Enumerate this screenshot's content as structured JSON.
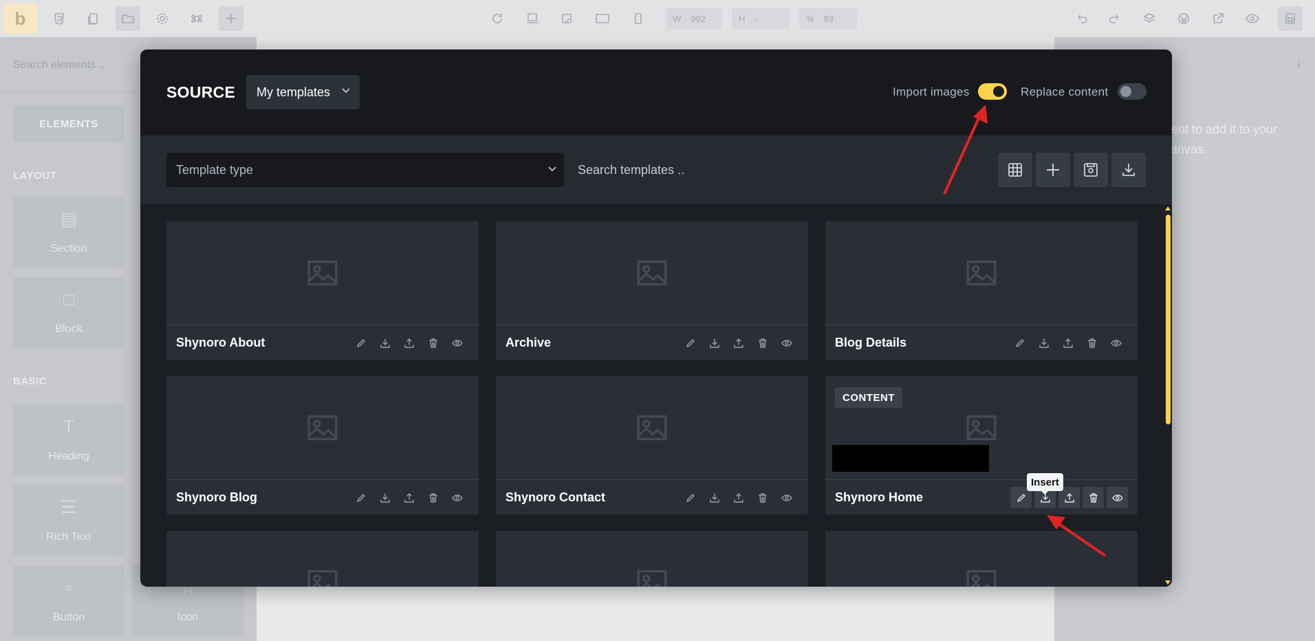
{
  "app": {
    "logo": "b",
    "toolbar": {
      "width_label": "W",
      "width_value": "992",
      "height_label": "H",
      "height_value": "-",
      "zoom_value": "93"
    }
  },
  "left_panel": {
    "search_placeholder": "Search elements ..",
    "tab_elements": "ELEMENTS",
    "group_layout": "LAYOUT",
    "group_basic": "BASIC",
    "items": [
      {
        "label": "Section",
        "icon": "section-icon"
      },
      {
        "label": "Block",
        "icon": "block-icon"
      },
      {
        "label": "Heading",
        "icon": "heading-icon"
      },
      {
        "label": "Rich Text",
        "icon": "rich-text-icon"
      },
      {
        "label": "Button",
        "icon": "button-icon"
      },
      {
        "label": "Icon",
        "icon": "star-icon"
      }
    ]
  },
  "right_panel": {
    "hint": "nent to add it to your\ncanvas."
  },
  "modal": {
    "title": "SOURCE",
    "source_select": "My templates",
    "import_images_label": "Import images",
    "import_images_on": true,
    "replace_content_label": "Replace content",
    "replace_content_on": false,
    "template_type_placeholder": "Template type",
    "search_placeholder": "Search templates ..",
    "tools": [
      "grid-icon",
      "plus-icon",
      "save-icon",
      "download-icon"
    ],
    "templates": [
      {
        "name": "Shynoro About"
      },
      {
        "name": "Archive"
      },
      {
        "name": "Blog Details"
      },
      {
        "name": "Shynoro Blog"
      },
      {
        "name": "Shynoro Contact"
      },
      {
        "name": "Shynoro Home",
        "badge": "CONTENT",
        "active": true
      }
    ],
    "tooltip": "Insert"
  },
  "colors": {
    "accent": "#fcd34d",
    "arrow": "#e02424",
    "modal_bg": "#1b1f24",
    "card_bg": "#2a2f37"
  }
}
